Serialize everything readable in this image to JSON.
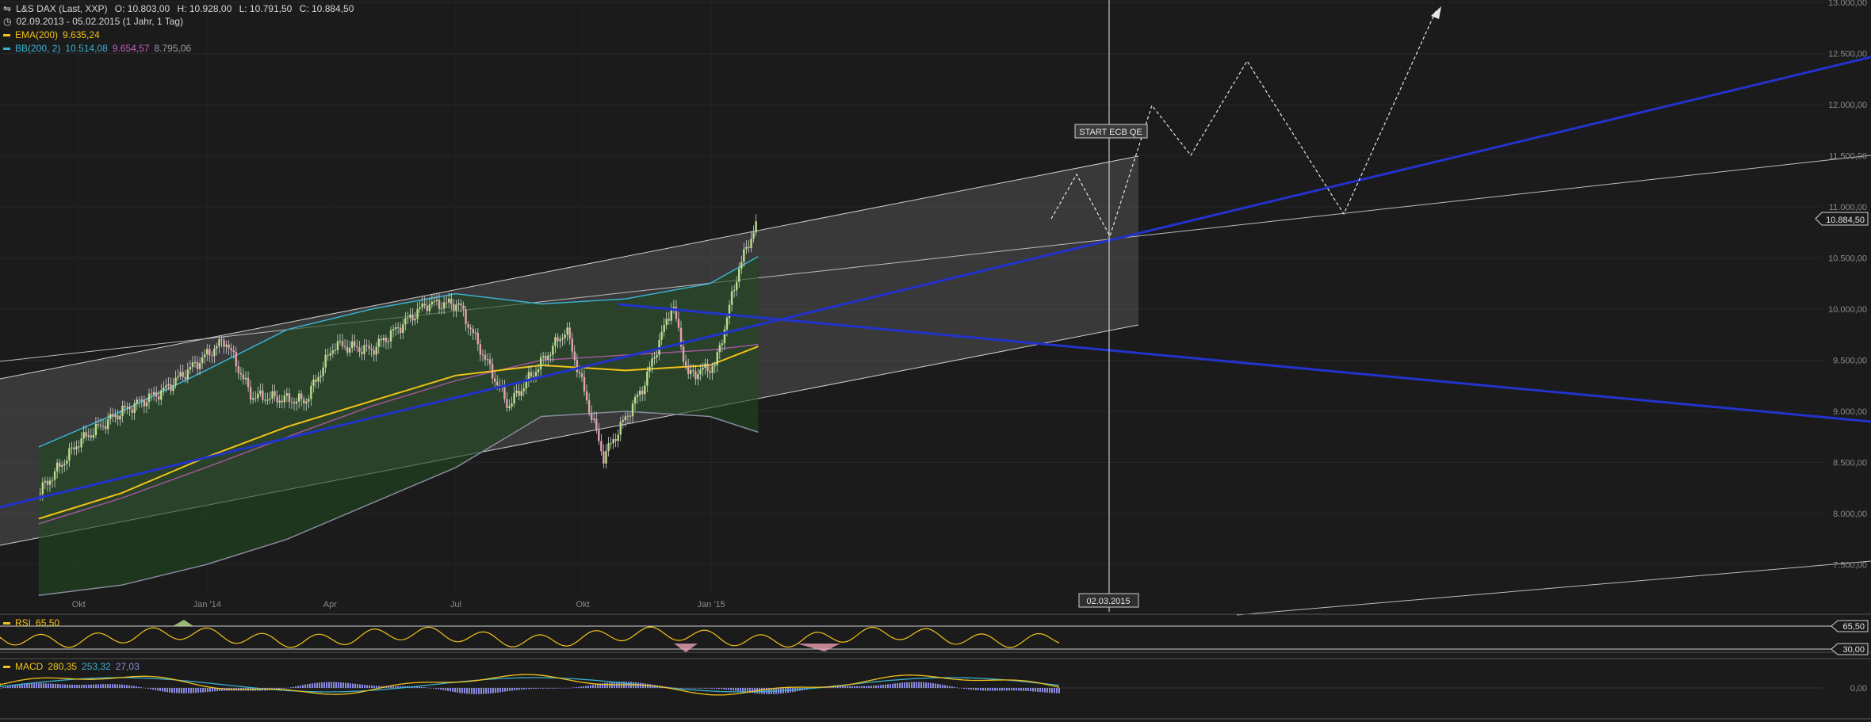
{
  "header": {
    "instrument": "L&S DAX (Last, XXP)",
    "ohlc": {
      "o": "O: 10.803,00",
      "h": "H: 10.928,00",
      "l": "L: 10.791,50",
      "c": "C: 10.884,50"
    },
    "range": "02.09.2013 - 05.02.2015 (1 Jahr, 1 Tag)",
    "ema_label": "EMA(200)",
    "ema_value": "9.635,24",
    "bb_label": "BB(200, 2)",
    "bb_upper": "10.514,08",
    "bb_mid": "9.654,57",
    "bb_lower": "8.795,06"
  },
  "colors": {
    "background": "#1b1b1b",
    "bull": "#b8e08a",
    "bear": "#e8a0b0",
    "ema": "#f2c218",
    "bb_upper": "#3ab0d0",
    "bb_mid": "#a0569a",
    "bb_lower": "#8a8aa0",
    "trend_blue": "#2233cc",
    "rsi": "#f2c218",
    "macd": "#f2c218",
    "signal": "#3ab0d0",
    "hist": "#8a8ae0"
  },
  "annotations": {
    "ecb_label": "START ECB QE",
    "cursor_date": "02.03.2015",
    "last_price": "10.884,50"
  },
  "rsi": {
    "label": "RSI",
    "value": "65,50",
    "level_high": "65,50",
    "level_low": "30,00"
  },
  "macd": {
    "label": "MACD",
    "macd": "280,35",
    "signal": "253,32",
    "hist": "27,03",
    "zero_label": "0,00"
  },
  "chart_data": {
    "type": "line",
    "title": "L&S DAX (Last, XXP)",
    "x_ticks": [
      "Okt",
      "Jan '14",
      "Apr",
      "Jul",
      "Okt",
      "Jan '15"
    ],
    "y_ticks": [
      "13.000,00",
      "12.500,00",
      "12.000,00",
      "11.500,00",
      "11.000,00",
      "10.500,00",
      "10.000,00",
      "9.500,00",
      "9.000,00",
      "8.500,00",
      "8.000,00",
      "7.500,00"
    ],
    "ylim": [
      7000,
      13000
    ],
    "series": [
      {
        "name": "EMA(200)",
        "x": [
          "2013-09-02",
          "2013-11-01",
          "2014-01-01",
          "2014-03-01",
          "2014-05-01",
          "2014-07-01",
          "2014-09-01",
          "2014-11-01",
          "2015-01-01",
          "2015-02-05"
        ],
        "values": [
          7950,
          8200,
          8550,
          8850,
          9100,
          9350,
          9450,
          9400,
          9450,
          9635
        ]
      },
      {
        "name": "BB(200, 2)",
        "x": [
          "2013-09-02",
          "2013-11-01",
          "2014-01-01",
          "2014-03-01",
          "2014-05-01",
          "2014-07-01",
          "2014-09-01",
          "2014-11-01",
          "2015-01-01",
          "2015-02-05"
        ],
        "values": [
          8650,
          9000,
          9400,
          9800,
          10000,
          10150,
          10050,
          10100,
          10250,
          10514
        ]
      },
      {
        "name": "BB(200, 2) mid",
        "x": [
          "2013-09-02",
          "2013-11-01",
          "2014-01-01",
          "2014-03-01",
          "2014-05-01",
          "2014-07-01",
          "2014-09-01",
          "2014-11-01",
          "2015-01-01",
          "2015-02-05"
        ],
        "values": [
          7900,
          8150,
          8450,
          8750,
          9050,
          9300,
          9500,
          9550,
          9600,
          9654
        ]
      },
      {
        "name": "BB(200, 2) lower",
        "x": [
          "2013-09-02",
          "2013-11-01",
          "2014-01-01",
          "2014-03-01",
          "2014-05-01",
          "2014-07-01",
          "2014-09-01",
          "2014-11-01",
          "2015-01-01",
          "2015-02-05"
        ],
        "values": [
          7200,
          7300,
          7500,
          7750,
          8100,
          8450,
          8950,
          9000,
          8950,
          8795
        ]
      },
      {
        "name": "Close",
        "x": [
          "2013-09-02",
          "2013-10-01",
          "2013-11-01",
          "2013-12-01",
          "2014-01-15",
          "2014-02-03",
          "2014-03-14",
          "2014-04-04",
          "2014-05-01",
          "2014-06-10",
          "2014-07-03",
          "2014-08-08",
          "2014-09-19",
          "2014-10-16",
          "2014-11-14",
          "2014-12-05",
          "2014-12-16",
          "2015-01-05",
          "2015-01-22",
          "2015-02-05"
        ],
        "values": [
          8200,
          8700,
          9000,
          9200,
          9700,
          9150,
          9100,
          9650,
          9600,
          10050,
          10050,
          9050,
          9800,
          8550,
          9250,
          10050,
          9350,
          9450,
          10400,
          10884
        ]
      }
    ]
  }
}
